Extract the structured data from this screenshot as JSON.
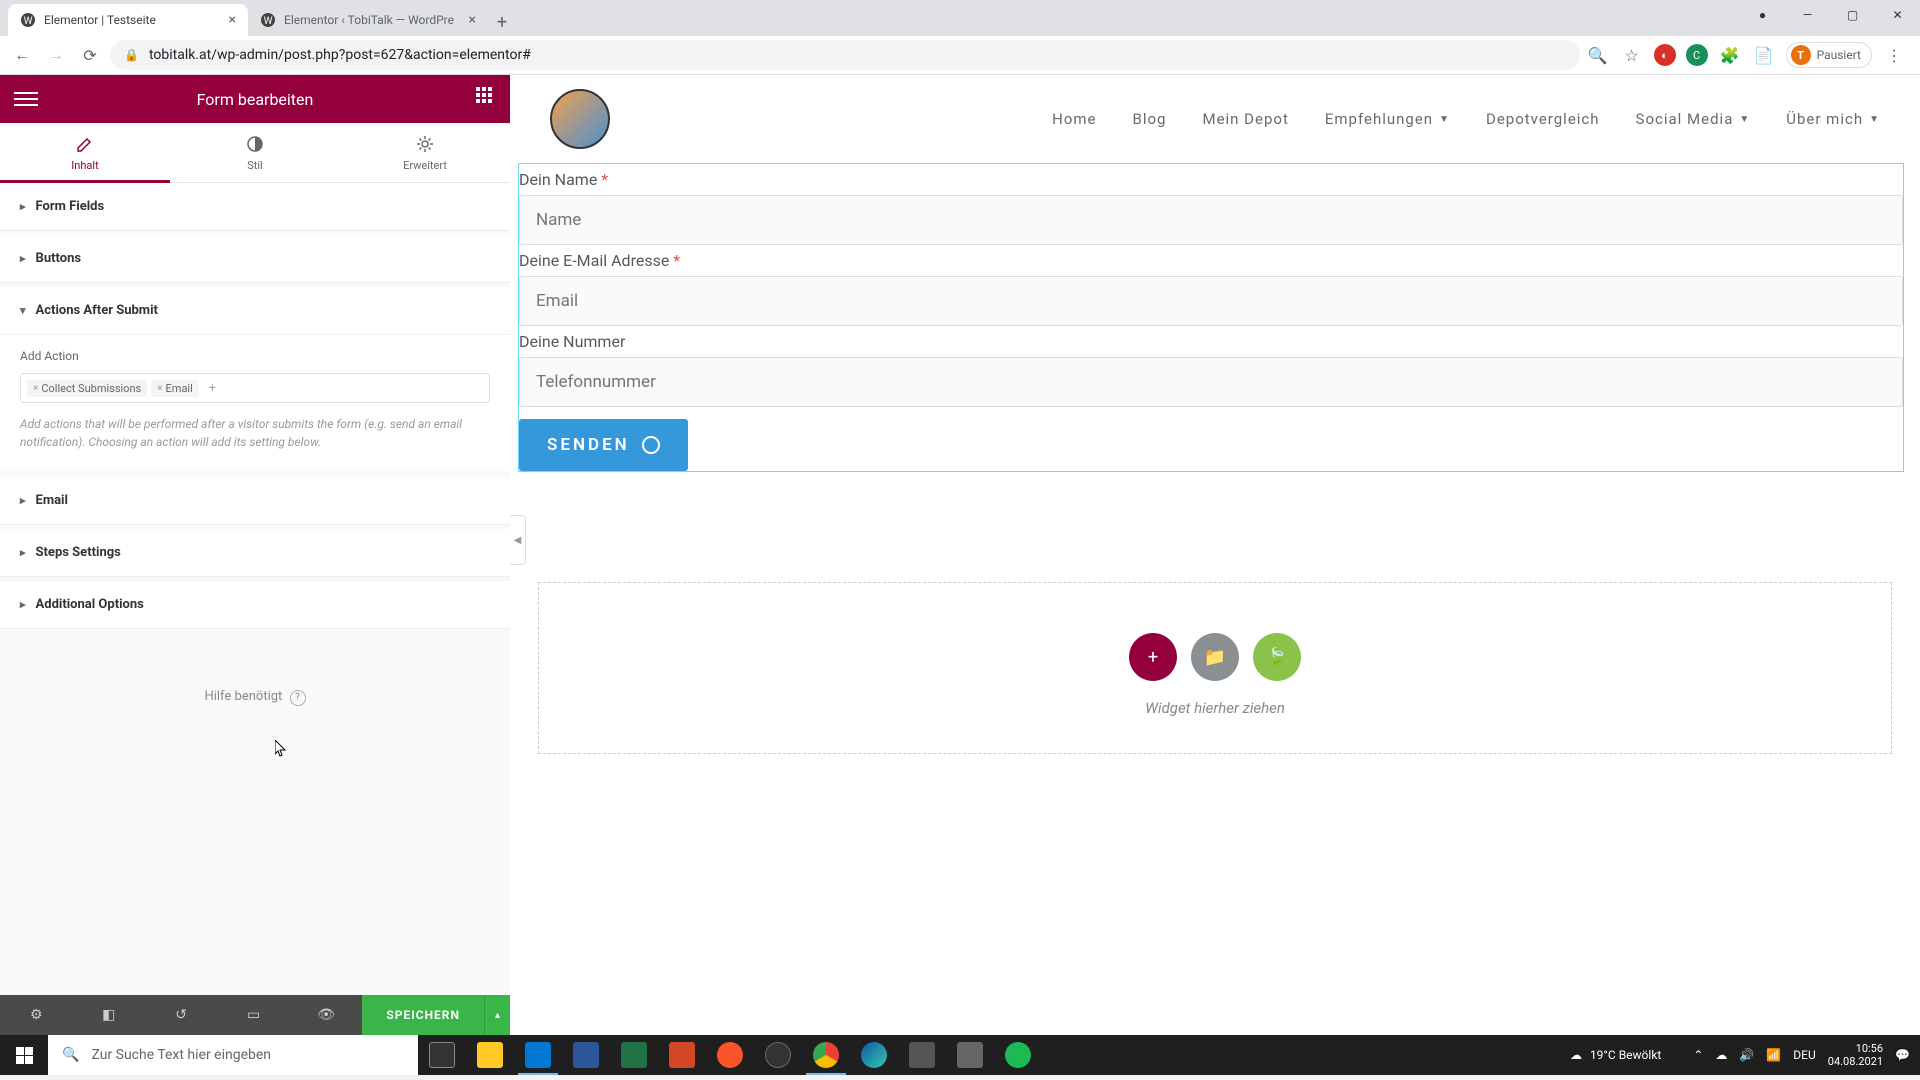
{
  "browser": {
    "tabs": [
      {
        "title": "Elementor | Testseite",
        "active": true
      },
      {
        "title": "Elementor ‹ TobiTalk — WordPre",
        "active": false
      }
    ],
    "url": "tobitalk.at/wp-admin/post.php?post=627&action=elementor#",
    "profile_label": "Pausiert",
    "profile_initial": "T"
  },
  "sidebar": {
    "title": "Form bearbeiten",
    "tabs": {
      "content": "Inhalt",
      "style": "Stil",
      "advanced": "Erweitert"
    },
    "sections": {
      "form_fields": "Form Fields",
      "buttons": "Buttons",
      "actions": "Actions After Submit",
      "email": "Email",
      "steps": "Steps Settings",
      "additional": "Additional Options"
    },
    "actions_panel": {
      "add_action_label": "Add Action",
      "tags": [
        "Collect Submissions",
        "Email"
      ],
      "help_text": "Add actions that will be performed after a visitor submits the form (e.g. send an email notification). Choosing an action will add its setting below."
    },
    "help_link": "Hilfe benötigt",
    "save_button": "SPEICHERN"
  },
  "site": {
    "nav": [
      "Home",
      "Blog",
      "Mein Depot",
      "Empfehlungen",
      "Depotvergleich",
      "Social Media",
      "Über mich"
    ],
    "nav_dropdown": {
      "Empfehlungen": true,
      "Social Media": true,
      "Über mich": true
    }
  },
  "form": {
    "fields": [
      {
        "label": "Dein Name",
        "required": true,
        "placeholder": "Name"
      },
      {
        "label": "Deine E-Mail Adresse",
        "required": true,
        "placeholder": "Email"
      },
      {
        "label": "Deine Nummer",
        "required": false,
        "placeholder": "Telefonnummer"
      }
    ],
    "submit_label": "SENDEN"
  },
  "dropzone": {
    "text": "Widget hierher ziehen"
  },
  "taskbar": {
    "search_placeholder": "Zur Suche Text hier eingeben",
    "weather": "19°C  Bewölkt",
    "lang": "DEU",
    "time": "10:56",
    "date": "04.08.2021"
  }
}
